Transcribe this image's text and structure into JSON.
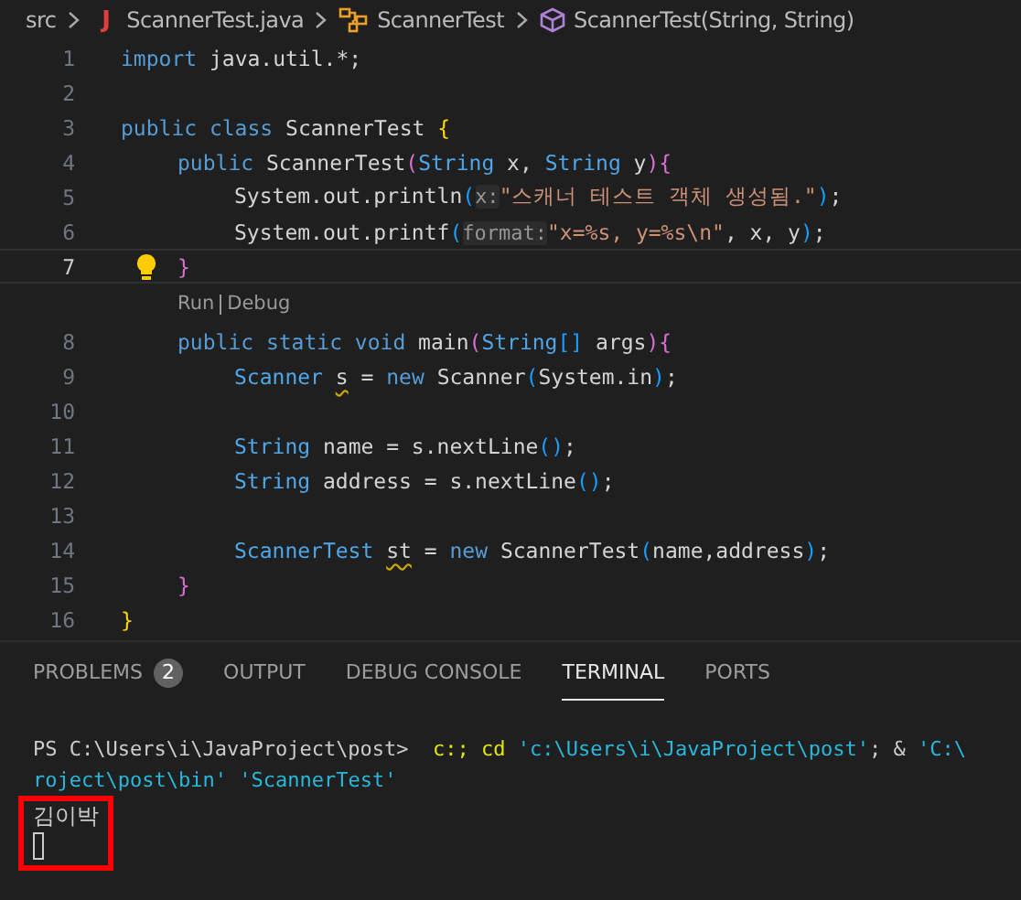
{
  "breadcrumb": [
    {
      "kind": "folder",
      "text": "src"
    },
    {
      "kind": "file",
      "icon_text": "J",
      "text": "ScannerTest.java"
    },
    {
      "kind": "class",
      "text": "ScannerTest"
    },
    {
      "kind": "method",
      "text": "ScannerTest(String, String)"
    }
  ],
  "editor": {
    "lines": [
      {
        "kind": "code",
        "number": "1",
        "current": false,
        "lightbulb": false,
        "tokens": [
          {
            "kind": "keyword",
            "text": "import"
          },
          {
            "kind": "plain",
            "text": " java.util.*;"
          }
        ]
      },
      {
        "kind": "code",
        "number": "2",
        "current": false,
        "lightbulb": false
      },
      {
        "kind": "code",
        "number": "3",
        "current": false,
        "lightbulb": false,
        "tokens": [
          {
            "kind": "keyword",
            "text": "public class"
          },
          {
            "kind": "plain",
            "text": " ScannerTest "
          },
          {
            "kind": "bracket",
            "color": "#ffd700",
            "text": "{"
          }
        ],
        "children": [
          {
            "kind": "code",
            "number": "4",
            "current": false,
            "lightbulb": false,
            "tokens": [
              {
                "kind": "keyword",
                "text": "public"
              },
              {
                "kind": "plain",
                "text": " ScannerTest"
              },
              {
                "kind": "bracket",
                "color": "#da70d6",
                "text": "("
              },
              {
                "kind": "type",
                "text": "String"
              },
              {
                "kind": "plain",
                "text": " x, "
              },
              {
                "kind": "type",
                "text": "String"
              },
              {
                "kind": "plain",
                "text": " y"
              },
              {
                "kind": "bracket",
                "color": "#da70d6",
                "text": "){"
              }
            ],
            "children": [
              {
                "kind": "code",
                "number": "5",
                "current": false,
                "lightbulb": false,
                "tokens": [
                  {
                    "kind": "plain",
                    "text": "System.out.println"
                  },
                  {
                    "kind": "bracket",
                    "color": "#179fff",
                    "text": "("
                  },
                  {
                    "kind": "hint",
                    "text": "x:"
                  },
                  {
                    "kind": "string",
                    "text": "\"스캐너 테스트 객체 생성됨.\""
                  },
                  {
                    "kind": "bracket",
                    "color": "#179fff",
                    "text": ")"
                  },
                  {
                    "kind": "plain",
                    "text": ";"
                  }
                ]
              },
              {
                "kind": "code",
                "number": "6",
                "current": false,
                "lightbulb": false,
                "tokens": [
                  {
                    "kind": "plain",
                    "text": "System.out.printf"
                  },
                  {
                    "kind": "bracket",
                    "color": "#179fff",
                    "text": "("
                  },
                  {
                    "kind": "hint",
                    "text": "format:"
                  },
                  {
                    "kind": "string",
                    "text": "\"x=%s, y=%s\\n\""
                  },
                  {
                    "kind": "plain",
                    "text": ", x, y"
                  },
                  {
                    "kind": "bracket",
                    "color": "#179fff",
                    "text": ")"
                  },
                  {
                    "kind": "plain",
                    "text": ";"
                  }
                ]
              }
            ]
          },
          {
            "kind": "code",
            "number": "7",
            "current": true,
            "lightbulb": true,
            "tokens": [
              {
                "kind": "bracket",
                "color": "#da70d6",
                "text": "}"
              }
            ]
          },
          {
            "kind": "codelens",
            "links": [
              "Run",
              "Debug"
            ]
          },
          {
            "kind": "code",
            "number": "8",
            "current": false,
            "lightbulb": false,
            "tokens": [
              {
                "kind": "keyword",
                "text": "public static void"
              },
              {
                "kind": "plain",
                "text": " main"
              },
              {
                "kind": "bracket",
                "color": "#da70d6",
                "text": "("
              },
              {
                "kind": "type",
                "text": "String"
              },
              {
                "kind": "bracket",
                "color": "#179fff",
                "text": "[]"
              },
              {
                "kind": "plain",
                "text": " args"
              },
              {
                "kind": "bracket",
                "color": "#da70d6",
                "text": "){"
              }
            ],
            "children": [
              {
                "kind": "code",
                "number": "9",
                "current": false,
                "lightbulb": false,
                "tokens": [
                  {
                    "kind": "type",
                    "text": "Scanner "
                  },
                  {
                    "kind": "warning",
                    "text": "s"
                  },
                  {
                    "kind": "plain",
                    "text": " = "
                  },
                  {
                    "kind": "keyword",
                    "text": "new"
                  },
                  {
                    "kind": "plain",
                    "text": " Scanner"
                  },
                  {
                    "kind": "bracket",
                    "color": "#179fff",
                    "text": "("
                  },
                  {
                    "kind": "plain",
                    "text": "System.in"
                  },
                  {
                    "kind": "bracket",
                    "color": "#179fff",
                    "text": ")"
                  },
                  {
                    "kind": "plain",
                    "text": ";"
                  }
                ]
              },
              {
                "kind": "code",
                "number": "10",
                "current": false,
                "lightbulb": false
              },
              {
                "kind": "code",
                "number": "11",
                "current": false,
                "lightbulb": false,
                "tokens": [
                  {
                    "kind": "type",
                    "text": "String"
                  },
                  {
                    "kind": "plain",
                    "text": " name = s.nextLine"
                  },
                  {
                    "kind": "bracket",
                    "color": "#179fff",
                    "text": "()"
                  },
                  {
                    "kind": "plain",
                    "text": ";"
                  }
                ]
              },
              {
                "kind": "code",
                "number": "12",
                "current": false,
                "lightbulb": false,
                "tokens": [
                  {
                    "kind": "type",
                    "text": "String"
                  },
                  {
                    "kind": "plain",
                    "text": " address = s.nextLine"
                  },
                  {
                    "kind": "bracket",
                    "color": "#179fff",
                    "text": "()"
                  },
                  {
                    "kind": "plain",
                    "text": ";"
                  }
                ]
              },
              {
                "kind": "code",
                "number": "13",
                "current": false,
                "lightbulb": false
              },
              {
                "kind": "code",
                "number": "14",
                "current": false,
                "lightbulb": false,
                "tokens": [
                  {
                    "kind": "type",
                    "text": "ScannerTest "
                  },
                  {
                    "kind": "warning",
                    "text": "st"
                  },
                  {
                    "kind": "plain",
                    "text": " = "
                  },
                  {
                    "kind": "keyword",
                    "text": "new"
                  },
                  {
                    "kind": "plain",
                    "text": " ScannerTest"
                  },
                  {
                    "kind": "bracket",
                    "color": "#179fff",
                    "text": "("
                  },
                  {
                    "kind": "plain",
                    "text": "name,address"
                  },
                  {
                    "kind": "bracket",
                    "color": "#179fff",
                    "text": ")"
                  },
                  {
                    "kind": "plain",
                    "text": ";"
                  }
                ]
              }
            ]
          },
          {
            "kind": "code",
            "number": "15",
            "current": false,
            "lightbulb": false,
            "tokens": [
              {
                "kind": "bracket",
                "color": "#da70d6",
                "text": "}"
              }
            ]
          }
        ]
      },
      {
        "kind": "code",
        "number": "16",
        "current": false,
        "lightbulb": false,
        "tokens": [
          {
            "kind": "bracket",
            "color": "#ffd700",
            "text": "}"
          }
        ]
      }
    ]
  },
  "panel": {
    "tabs": [
      {
        "label": "PROBLEMS",
        "badge": "2",
        "selected": false
      },
      {
        "label": "OUTPUT",
        "selected": false
      },
      {
        "label": "DEBUG CONSOLE",
        "selected": false
      },
      {
        "label": "TERMINAL",
        "selected": true
      },
      {
        "label": "PORTS",
        "selected": false
      }
    ],
    "terminal": {
      "lines": [
        {
          "tokens": [
            {
              "kind": "plain",
              "text": "PS C:\\Users\\i\\JavaProject\\post>  "
            },
            {
              "kind": "command",
              "text": "c:; "
            },
            {
              "kind": "command",
              "text": "cd "
            },
            {
              "kind": "string",
              "text": "'c:\\Users\\i\\JavaProject\\post'"
            },
            {
              "kind": "plain",
              "text": "; & "
            },
            {
              "kind": "string",
              "text": "'C:\\"
            }
          ]
        },
        {
          "tokens": [
            {
              "kind": "string",
              "text": "roject\\post\\bin' "
            },
            {
              "kind": "string",
              "text": "'ScannerTest'"
            }
          ]
        }
      ],
      "highlight": {
        "lines": [
          {
            "tokens": [
              {
                "kind": "plain",
                "text": "김이박"
              }
            ]
          }
        ],
        "cursor": true
      }
    }
  }
}
